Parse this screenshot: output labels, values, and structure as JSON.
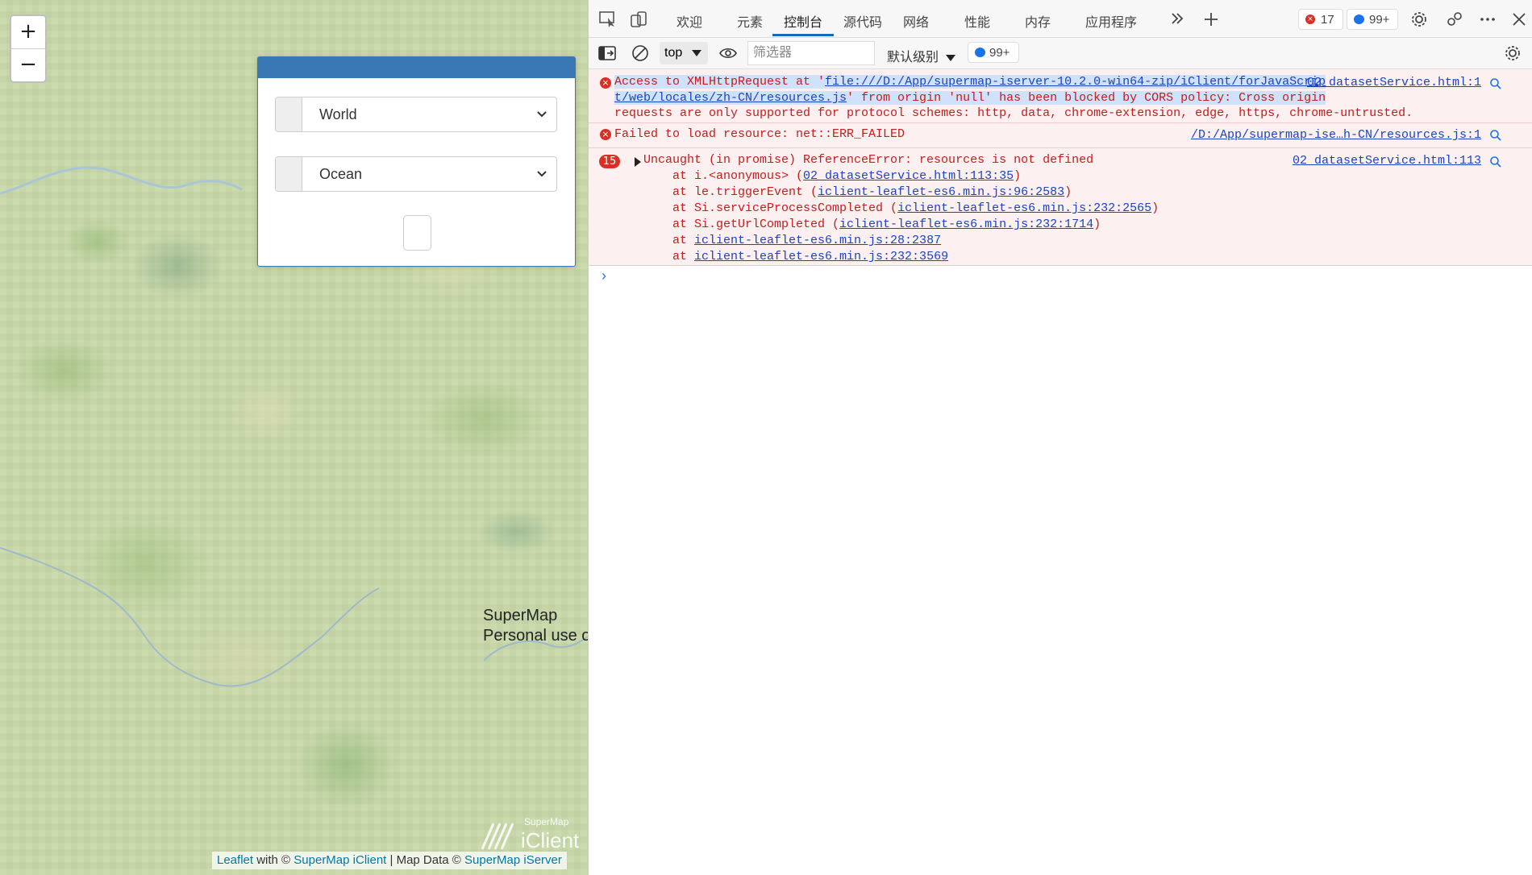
{
  "map": {
    "zoom_in": "+",
    "zoom_out": "−",
    "select_dataset": "World",
    "select_layer": "Ocean",
    "watermark_line1": "SuperMap",
    "watermark_line2": "Personal use o",
    "logo_top": "SuperMap",
    "logo_bottom": "iClient",
    "attribution": {
      "leaflet": "Leaflet",
      "with": " with © ",
      "iclient": "SuperMap iClient",
      "sep": " | Map Data © ",
      "iserver": "SuperMap iServer"
    }
  },
  "devtools": {
    "tabs": [
      "欢迎",
      "元素",
      "控制台",
      "源代码",
      "网络",
      "性能",
      "内存",
      "应用程序"
    ],
    "error_count": "17",
    "message_count": "99+",
    "context": "top",
    "filter_placeholder": "筛选器",
    "level": "默认级别",
    "toolbar_message_count": "99+",
    "messages": {
      "cors": {
        "pre": "Access to XMLHttpRequest at '",
        "url1": "file:///D:/App/supermap-iserver-10.2.0-win64-zip/iClient/forJavaScrip",
        "url2": "t/web/locales/zh-CN/resources.js",
        "post": "' from origin 'null' has been blocked by CORS policy: Cross origin",
        "line3": "requests are only supported for protocol schemes: http, data, chrome-extension, edge, https, chrome-untrusted.",
        "source": "02_datasetService.html:1"
      },
      "failed": {
        "text": "Failed to load resource: net::ERR_FAILED",
        "source": "/D:/App/supermap-ise…h-CN/resources.js:1"
      },
      "uncaught": {
        "count": "15",
        "text": "Uncaught (in promise) ReferenceError: resources is not defined",
        "source": "02_datasetService.html:113",
        "stack": [
          {
            "prefix": "    at i.<anonymous> (",
            "link": "02_datasetService.html:113:35",
            "suffix": ")"
          },
          {
            "prefix": "    at le.triggerEvent (",
            "link": "iclient-leaflet-es6.min.js:96:2583",
            "suffix": ")"
          },
          {
            "prefix": "    at Si.serviceProcessCompleted (",
            "link": "iclient-leaflet-es6.min.js:232:2565",
            "suffix": ")"
          },
          {
            "prefix": "    at Si.getUrlCompleted (",
            "link": "iclient-leaflet-es6.min.js:232:1714",
            "suffix": ")"
          },
          {
            "prefix": "    at ",
            "link": "iclient-leaflet-es6.min.js:28:2387",
            "suffix": ""
          },
          {
            "prefix": "    at ",
            "link": "iclient-leaflet-es6.min.js:232:3569",
            "suffix": ""
          }
        ]
      }
    },
    "prompt": "›"
  }
}
